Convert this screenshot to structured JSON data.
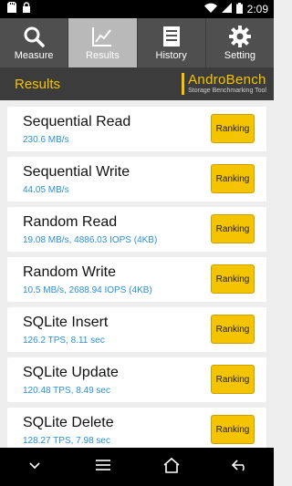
{
  "status_bar": {
    "time": "2:09"
  },
  "tabs": [
    {
      "label": "Measure",
      "icon": "search-icon"
    },
    {
      "label": "Results",
      "icon": "chart-icon",
      "active": true
    },
    {
      "label": "History",
      "icon": "document-icon"
    },
    {
      "label": "Setting",
      "icon": "gear-icon"
    }
  ],
  "header": {
    "title": "Results",
    "brand_name": "AndroBench",
    "brand_tagline": "Storage Benchmarking Tool"
  },
  "results": [
    {
      "name": "Sequential Read",
      "value": "230.6 MB/s",
      "button": "Ranking"
    },
    {
      "name": "Sequential Write",
      "value": "44.05 MB/s",
      "button": "Ranking"
    },
    {
      "name": "Random Read",
      "value": "19.08 MB/s, 4886.03 IOPS (4KB)",
      "button": "Ranking"
    },
    {
      "name": "Random Write",
      "value": "10.5 MB/s, 2688.94 IOPS (4KB)",
      "button": "Ranking"
    },
    {
      "name": "SQLite Insert",
      "value": "126.2 TPS, 8.11 sec",
      "button": "Ranking"
    },
    {
      "name": "SQLite Update",
      "value": "120.48 TPS, 8.49 sec",
      "button": "Ranking"
    },
    {
      "name": "SQLite Delete",
      "value": "128.27 TPS, 7.98 sec",
      "button": "Ranking"
    }
  ],
  "colors": {
    "accent": "#f5c400",
    "value_text": "#2a8fd6",
    "tabbar_bg": "#4f4f4f",
    "header_bg": "#3c3c3c"
  }
}
